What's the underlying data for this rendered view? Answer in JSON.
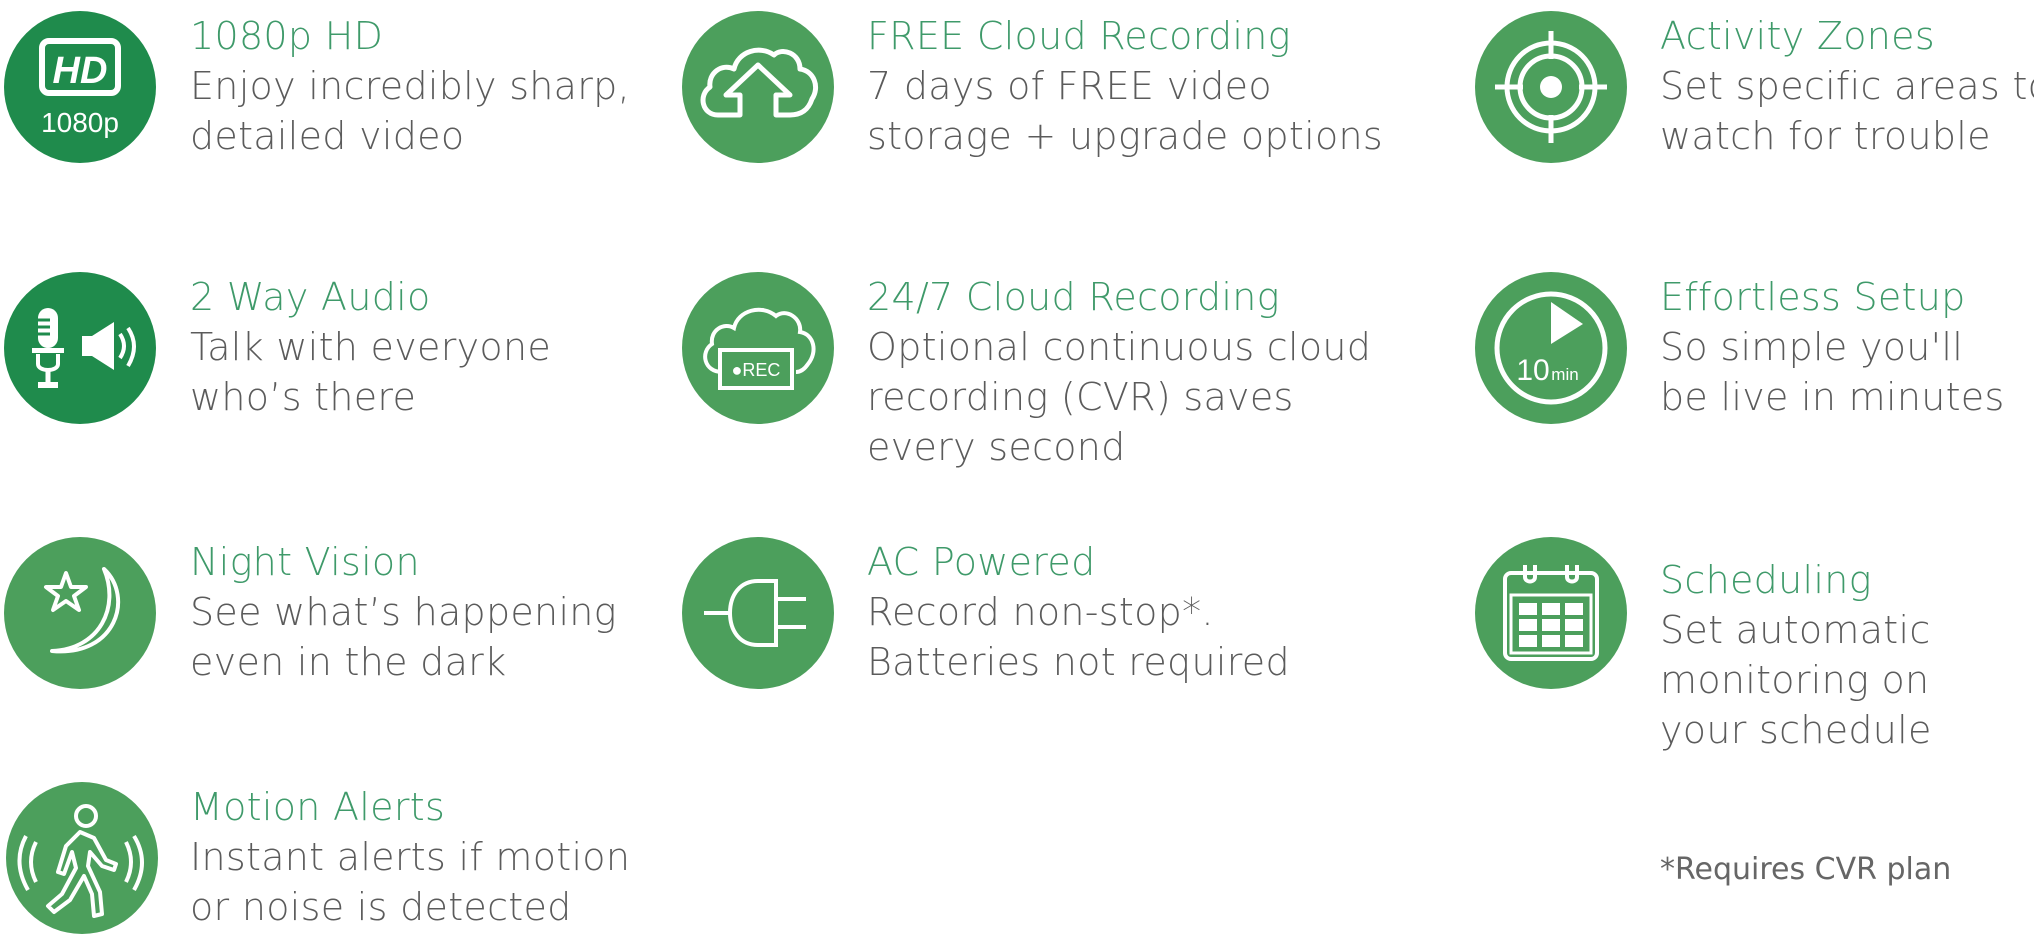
{
  "colors": {
    "circle_dark": "#1f8b4c",
    "circle_light": "#4c9f5c",
    "title": "#3f9a6a",
    "body": "#5b5b5b",
    "icon_stroke": "#ffffff"
  },
  "features": [
    {
      "id": "hd",
      "icon": "hd-1080p-icon",
      "icon_label": "HD",
      "icon_sublabel": "1080p",
      "title": "1080p HD",
      "lines": [
        "Enjoy incredibly sharp,",
        "detailed video"
      ]
    },
    {
      "id": "free-cloud",
      "icon": "cloud-upload-icon",
      "title": "FREE Cloud Recording",
      "lines": [
        "7 days of FREE video",
        "storage + upgrade options"
      ]
    },
    {
      "id": "activity-zones",
      "icon": "crosshair-target-icon",
      "title": "Activity Zones",
      "lines": [
        "Set specific areas to",
        "watch for trouble"
      ]
    },
    {
      "id": "two-way-audio",
      "icon": "microphone-speaker-icon",
      "title": "2 Way Audio",
      "lines": [
        "Talk with everyone",
        "who’s there"
      ]
    },
    {
      "id": "cvr",
      "icon": "cloud-rec-icon",
      "icon_label": "●REC",
      "title": "24/7 Cloud Recording",
      "lines": [
        "Optional continuous cloud",
        "recording (CVR) saves",
        "every second"
      ]
    },
    {
      "id": "setup",
      "icon": "timer-10min-icon",
      "icon_label": "10",
      "icon_sublabel": "min",
      "title": "Effortless Setup",
      "lines": [
        "So simple you'll",
        "be live in minutes"
      ]
    },
    {
      "id": "night-vision",
      "icon": "moon-star-icon",
      "title": "Night Vision",
      "lines": [
        "See what’s happening",
        "even in the dark"
      ]
    },
    {
      "id": "ac-powered",
      "icon": "power-plug-icon",
      "title": "AC Powered",
      "lines": [
        "Record non-stop*.",
        "Batteries not required"
      ]
    },
    {
      "id": "scheduling",
      "icon": "calendar-icon",
      "title": "Scheduling",
      "lines": [
        "Set automatic",
        "monitoring on",
        "your schedule"
      ]
    },
    {
      "id": "motion-alerts",
      "icon": "walking-person-motion-icon",
      "title": "Motion Alerts",
      "lines": [
        "Instant alerts if motion",
        "or noise is detected"
      ]
    }
  ],
  "footnote": "*Requires CVR plan"
}
